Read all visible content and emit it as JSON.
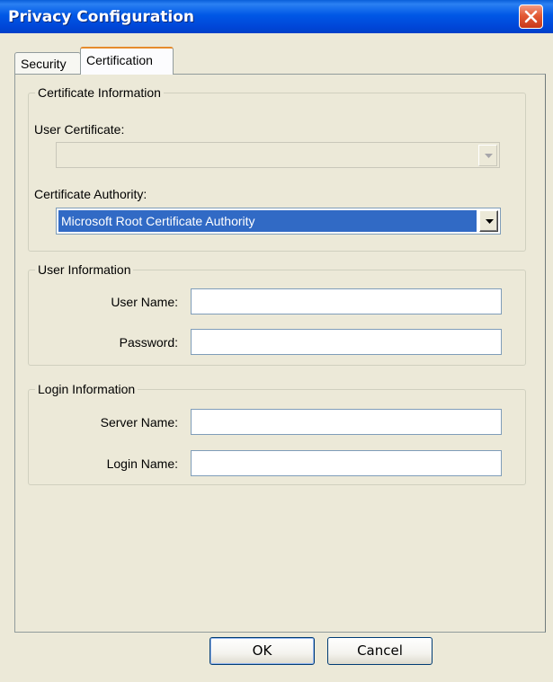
{
  "window": {
    "title": "Privacy Configuration"
  },
  "tabs": [
    {
      "label": "Security"
    },
    {
      "label": "Certification"
    }
  ],
  "certificate_information": {
    "group_title": "Certificate Information",
    "user_certificate_label": "User Certificate:",
    "user_certificate_value": "",
    "certificate_authority_label": "Certificate Authority:",
    "certificate_authority_value": "Microsoft Root Certificate Authority"
  },
  "user_information": {
    "group_title": "User Information",
    "user_name_label": "User Name:",
    "user_name_value": "",
    "password_label": "Password:",
    "password_value": ""
  },
  "login_information": {
    "group_title": "Login Information",
    "server_name_label": "Server Name:",
    "server_name_value": "",
    "login_name_label": "Login Name:",
    "login_name_value": ""
  },
  "buttons": {
    "ok_label": "OK",
    "cancel_label": "Cancel"
  }
}
